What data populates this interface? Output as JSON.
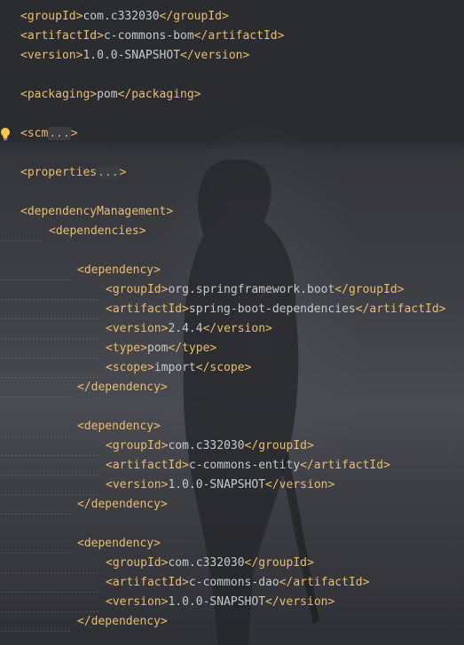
{
  "editor": {
    "lines": [
      {
        "indent": 0,
        "parts": [
          {
            "t": "<groupId>",
            "c": "tag"
          },
          {
            "t": "com.c332030",
            "c": "txt"
          },
          {
            "t": "</groupId>",
            "c": "tag"
          }
        ]
      },
      {
        "indent": 0,
        "parts": [
          {
            "t": "<artifactId>",
            "c": "tag"
          },
          {
            "t": "c-commons-bom",
            "c": "txt"
          },
          {
            "t": "</artifactId>",
            "c": "tag"
          }
        ]
      },
      {
        "indent": 0,
        "parts": [
          {
            "t": "<version>",
            "c": "tag"
          },
          {
            "t": "1.0.0-SNAPSHOT",
            "c": "txt"
          },
          {
            "t": "</version>",
            "c": "tag"
          }
        ]
      },
      {
        "indent": 0,
        "parts": []
      },
      {
        "indent": 0,
        "parts": [
          {
            "t": "<packaging>",
            "c": "tag"
          },
          {
            "t": "pom",
            "c": "txt"
          },
          {
            "t": "</packaging>",
            "c": "tag"
          }
        ]
      },
      {
        "indent": 0,
        "parts": []
      },
      {
        "indent": 0,
        "bulb": true,
        "parts": [
          {
            "t": "<scm",
            "c": "tag"
          },
          {
            "t": "...",
            "c": "fold"
          },
          {
            "t": ">",
            "c": "tag"
          }
        ]
      },
      {
        "indent": 0,
        "parts": []
      },
      {
        "indent": 0,
        "parts": [
          {
            "t": "<properties",
            "c": "tag"
          },
          {
            "t": "...",
            "c": "fold"
          },
          {
            "t": ">",
            "c": "tag"
          }
        ]
      },
      {
        "indent": 0,
        "parts": []
      },
      {
        "indent": 0,
        "parts": [
          {
            "t": "<dependencyManagement>",
            "c": "tag"
          }
        ]
      },
      {
        "indent": 1,
        "parts": [
          {
            "t": "<dependencies>",
            "c": "tag"
          }
        ]
      },
      {
        "indent": 0,
        "parts": []
      },
      {
        "indent": 2,
        "parts": [
          {
            "t": "<dependency>",
            "c": "tag"
          }
        ]
      },
      {
        "indent": 3,
        "parts": [
          {
            "t": "<groupId>",
            "c": "tag"
          },
          {
            "t": "org.springframework.boot",
            "c": "txt"
          },
          {
            "t": "</groupId>",
            "c": "tag"
          }
        ]
      },
      {
        "indent": 3,
        "parts": [
          {
            "t": "<artifactId>",
            "c": "tag"
          },
          {
            "t": "spring-boot-dependencies",
            "c": "txt"
          },
          {
            "t": "</artifactId>",
            "c": "tag"
          }
        ]
      },
      {
        "indent": 3,
        "parts": [
          {
            "t": "<version>",
            "c": "tag"
          },
          {
            "t": "2.4.4",
            "c": "txt"
          },
          {
            "t": "</version>",
            "c": "tag"
          }
        ]
      },
      {
        "indent": 3,
        "parts": [
          {
            "t": "<type>",
            "c": "tag"
          },
          {
            "t": "pom",
            "c": "txt"
          },
          {
            "t": "</type>",
            "c": "tag"
          }
        ]
      },
      {
        "indent": 3,
        "parts": [
          {
            "t": "<scope>",
            "c": "tag"
          },
          {
            "t": "import",
            "c": "txt"
          },
          {
            "t": "</scope>",
            "c": "tag"
          }
        ]
      },
      {
        "indent": 2,
        "parts": [
          {
            "t": "</dependency>",
            "c": "tag"
          }
        ]
      },
      {
        "indent": 0,
        "parts": []
      },
      {
        "indent": 2,
        "parts": [
          {
            "t": "<dependency>",
            "c": "tag"
          }
        ]
      },
      {
        "indent": 3,
        "parts": [
          {
            "t": "<groupId>",
            "c": "tag"
          },
          {
            "t": "com.c332030",
            "c": "txt"
          },
          {
            "t": "</groupId>",
            "c": "tag"
          }
        ]
      },
      {
        "indent": 3,
        "parts": [
          {
            "t": "<artifactId>",
            "c": "tag"
          },
          {
            "t": "c-commons-entity",
            "c": "txt"
          },
          {
            "t": "</artifactId>",
            "c": "tag"
          }
        ]
      },
      {
        "indent": 3,
        "parts": [
          {
            "t": "<version>",
            "c": "tag"
          },
          {
            "t": "1.0.0-SNAPSHOT",
            "c": "txt"
          },
          {
            "t": "</version>",
            "c": "tag"
          }
        ]
      },
      {
        "indent": 2,
        "parts": [
          {
            "t": "</dependency>",
            "c": "tag"
          }
        ]
      },
      {
        "indent": 0,
        "parts": []
      },
      {
        "indent": 2,
        "parts": [
          {
            "t": "<dependency>",
            "c": "tag"
          }
        ]
      },
      {
        "indent": 3,
        "parts": [
          {
            "t": "<groupId>",
            "c": "tag"
          },
          {
            "t": "com.c332030",
            "c": "txt"
          },
          {
            "t": "</groupId>",
            "c": "tag"
          }
        ]
      },
      {
        "indent": 3,
        "parts": [
          {
            "t": "<artifactId>",
            "c": "tag"
          },
          {
            "t": "c-commons-dao",
            "c": "txt"
          },
          {
            "t": "</artifactId>",
            "c": "tag"
          }
        ]
      },
      {
        "indent": 3,
        "parts": [
          {
            "t": "<version>",
            "c": "tag"
          },
          {
            "t": "1.0.0-SNAPSHOT",
            "c": "txt"
          },
          {
            "t": "</version>",
            "c": "tag"
          }
        ]
      },
      {
        "indent": 2,
        "parts": [
          {
            "t": "</dependency>",
            "c": "tag"
          }
        ]
      }
    ],
    "colors": {
      "tag": "#e8bf6a",
      "text": "#c9c9c9",
      "fold_bg": "#3b3d41",
      "background": "#2b2c30",
      "bulb": "#f2c94c"
    },
    "icons": {
      "intention": "lightbulb-icon"
    }
  }
}
